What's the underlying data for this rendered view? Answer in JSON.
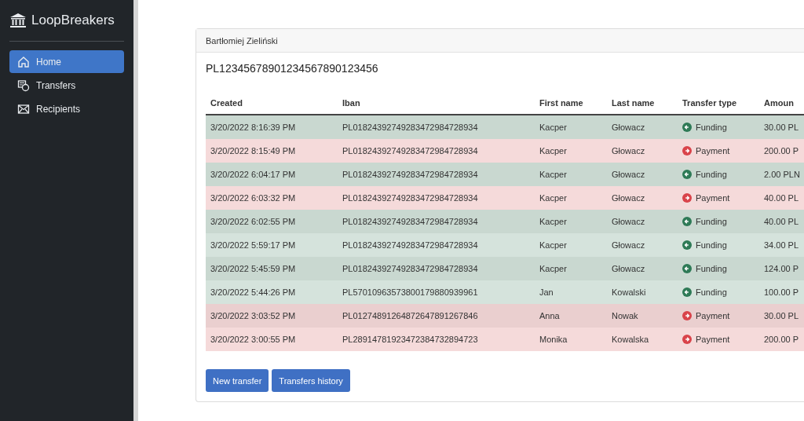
{
  "sidebar": {
    "brand": "LoopBreakers",
    "items": [
      {
        "label": "Home",
        "selected": true
      },
      {
        "label": "Transfers",
        "selected": false
      },
      {
        "label": "Recipients",
        "selected": false
      }
    ]
  },
  "card": {
    "header": "Bartłomiej Zieliński",
    "account": "PL12345678901234567890123456",
    "table": {
      "columns": [
        "Created",
        "Iban",
        "First name",
        "Last name",
        "Transfer type",
        "Amoun"
      ],
      "rows": [
        {
          "created": "3/20/2022 8:16:39 PM",
          "iban": "PL01824392749283472984728934",
          "first_name": "Kacper",
          "last_name": "Głowacz",
          "kind": "funding",
          "type": "Funding",
          "amount": "30.00 PL"
        },
        {
          "created": "3/20/2022 8:15:49 PM",
          "iban": "PL01824392749283472984728934",
          "first_name": "Kacper",
          "last_name": "Głowacz",
          "kind": "payment",
          "type": "Payment",
          "amount": "200.00 P"
        },
        {
          "created": "3/20/2022 6:04:17 PM",
          "iban": "PL01824392749283472984728934",
          "first_name": "Kacper",
          "last_name": "Głowacz",
          "kind": "funding",
          "type": "Funding",
          "amount": "2.00 PLN"
        },
        {
          "created": "3/20/2022 6:03:32 PM",
          "iban": "PL01824392749283472984728934",
          "first_name": "Kacper",
          "last_name": "Głowacz",
          "kind": "payment",
          "type": "Payment",
          "amount": "40.00 PL"
        },
        {
          "created": "3/20/2022 6:02:55 PM",
          "iban": "PL01824392749283472984728934",
          "first_name": "Kacper",
          "last_name": "Głowacz",
          "kind": "funding",
          "type": "Funding",
          "amount": "40.00 PL"
        },
        {
          "created": "3/20/2022 5:59:17 PM",
          "iban": "PL01824392749283472984728934",
          "first_name": "Kacper",
          "last_name": "Głowacz",
          "kind": "funding",
          "type": "Funding",
          "amount": "34.00 PL"
        },
        {
          "created": "3/20/2022 5:45:59 PM",
          "iban": "PL01824392749283472984728934",
          "first_name": "Kacper",
          "last_name": "Głowacz",
          "kind": "funding",
          "type": "Funding",
          "amount": "124.00 P"
        },
        {
          "created": "3/20/2022 5:44:26 PM",
          "iban": "PL57010963573800179880939961",
          "first_name": "Jan",
          "last_name": "Kowalski",
          "kind": "funding",
          "type": "Funding",
          "amount": "100.00 P"
        },
        {
          "created": "3/20/2022 3:03:52 PM",
          "iban": "PL01274891264872647891267846",
          "first_name": "Anna",
          "last_name": "Nowak",
          "kind": "payment",
          "type": "Payment",
          "amount": "30.00 PL"
        },
        {
          "created": "3/20/2022 3:00:55 PM",
          "iban": "PL28914781923472384732894723",
          "first_name": "Monika",
          "last_name": "Kowalska",
          "kind": "payment",
          "type": "Payment",
          "amount": "200.00 P"
        }
      ]
    },
    "buttons": [
      "New transfer",
      "Transfers history"
    ]
  }
}
